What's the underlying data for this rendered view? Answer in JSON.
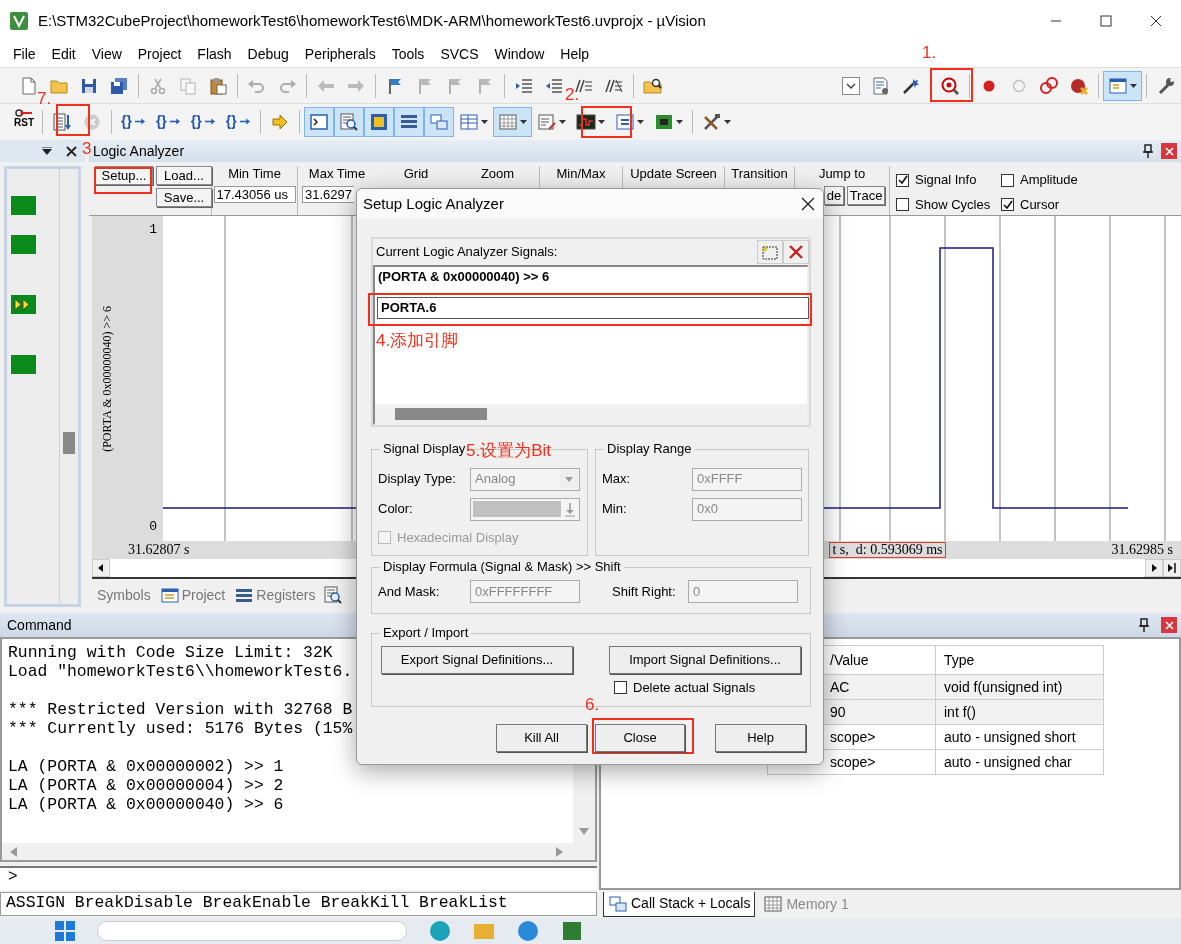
{
  "window": {
    "title": "E:\\STM32CubeProject\\homeworkTest6\\homeworkTest6\\MDK-ARM\\homeworkTest6.uvprojx - µVision"
  },
  "menu": [
    "File",
    "Edit",
    "View",
    "Project",
    "Flash",
    "Debug",
    "Peripherals",
    "Tools",
    "SVCS",
    "Window",
    "Help"
  ],
  "toolbar_1": {
    "left": [
      {
        "kind": "button",
        "disabled": false
      },
      {
        "kind": "button",
        "disabled": false
      },
      {
        "kind": "button",
        "disabled": false
      },
      {
        "kind": "button",
        "disabled": false
      },
      {
        "kind": "separator"
      },
      {
        "kind": "button",
        "disabled": true
      },
      {
        "kind": "button",
        "disabled": true
      },
      {
        "kind": "button",
        "disabled": false
      },
      {
        "kind": "separator"
      },
      {
        "kind": "button",
        "disabled": true
      },
      {
        "kind": "button",
        "disabled": true
      },
      {
        "kind": "separator"
      },
      {
        "kind": "button",
        "disabled": true
      },
      {
        "kind": "button",
        "disabled": true
      },
      {
        "kind": "separator"
      },
      {
        "kind": "button",
        "disabled": false
      },
      {
        "kind": "button",
        "disabled": true
      },
      {
        "kind": "button",
        "disabled": true
      },
      {
        "kind": "button",
        "disabled": true
      },
      {
        "kind": "separator"
      },
      {
        "kind": "button",
        "disabled": false
      },
      {
        "kind": "button",
        "disabled": false
      },
      {
        "kind": "button",
        "disabled": false
      },
      {
        "kind": "button",
        "disabled": false
      },
      {
        "kind": "separator"
      },
      {
        "kind": "button",
        "disabled": false
      }
    ],
    "right": [
      {
        "kind": "button",
        "disabled": false
      },
      {
        "kind": "button",
        "disabled": false
      },
      {
        "kind": "button",
        "disabled": false
      },
      {
        "kind": "separator"
      },
      {
        "kind": "button",
        "pressed": false
      },
      {
        "kind": "separator"
      },
      {
        "kind": "button",
        "disabled": false
      },
      {
        "kind": "button",
        "disabled": true
      },
      {
        "kind": "button",
        "disabled": false
      },
      {
        "kind": "button",
        "disabled": false
      },
      {
        "kind": "separator"
      },
      {
        "kind": "dropdown",
        "pressed": true
      },
      {
        "kind": "separator"
      },
      {
        "kind": "button",
        "disabled": false
      }
    ]
  },
  "toolbar_2": [
    {
      "kind": "button",
      "label": "RST"
    },
    {
      "kind": "separator"
    },
    {
      "kind": "button",
      "disabled": false
    },
    {
      "kind": "button",
      "disabled": true
    },
    {
      "kind": "separator"
    },
    {
      "kind": "button",
      "label": "{}"
    },
    {
      "kind": "button",
      "label": "{}"
    },
    {
      "kind": "button",
      "label": "{}"
    },
    {
      "kind": "button",
      "label": "{}"
    },
    {
      "kind": "separator"
    },
    {
      "kind": "button",
      "disabled": false
    },
    {
      "kind": "separator"
    },
    {
      "kind": "button",
      "pressed": true
    },
    {
      "kind": "button",
      "pressed": true
    },
    {
      "kind": "button",
      "pressed": true
    },
    {
      "kind": "button",
      "pressed": true
    },
    {
      "kind": "button",
      "pressed": true
    },
    {
      "kind": "dropdown",
      "pressed": false
    },
    {
      "kind": "dropdown",
      "pressed": true
    },
    {
      "kind": "dropdown",
      "pressed": false
    },
    {
      "kind": "dropdown",
      "pressed": false
    },
    {
      "kind": "dropdown",
      "pressed": false
    },
    {
      "kind": "dropdown",
      "pressed": false
    },
    {
      "kind": "separator"
    },
    {
      "kind": "dropdown",
      "pressed": false
    }
  ],
  "logic_analyzer": {
    "title": "Logic Analyzer",
    "buttons": [
      "Setup...",
      "Load...",
      "Save..."
    ],
    "min_time": {
      "label": "Min Time",
      "value": "17.43056 us"
    },
    "max_time": {
      "label": "Max Time",
      "value": "31.6297"
    },
    "headers": [
      "Grid",
      "Zoom",
      "Min/Max",
      "Update Screen",
      "Transition",
      "Jump to"
    ],
    "jump_buttons": [
      "de",
      "Trace"
    ],
    "options": [
      {
        "label": "Signal Info",
        "checked": true
      },
      {
        "label": "Amplitude",
        "checked": false
      },
      {
        "label": "Show Cycles",
        "checked": false
      },
      {
        "label": "Cursor",
        "checked": true
      }
    ],
    "y_max": "1",
    "y_min": "0",
    "signal_label": "(PORTA & 0x00000040) >> 6",
    "time_start": "31.62807 s",
    "cursor_info": "t s,  d: 0.593069 ms",
    "time_end": "31.62985 s"
  },
  "panel_tabs": [
    {
      "label": "Symbols",
      "selected": false
    },
    {
      "label": "Project",
      "selected": false
    },
    {
      "label": "Registers",
      "selected": false
    }
  ],
  "dialog": {
    "title": "Setup Logic Analyzer",
    "signals_label": "Current Logic Analyzer Signals:",
    "signals": [
      "(PORTA & 0x00000040) >> 6"
    ],
    "new_signal": "PORTA.6",
    "signal_display": {
      "title": "Signal Display",
      "disabled": true,
      "type_label": "Display Type:",
      "type": "Analog",
      "color_label": "Color:",
      "hex_label": "Hexadecimal Display",
      "hex_checked": false
    },
    "display_range": {
      "title": "Display Range",
      "disabled": true,
      "max_label": "Max:",
      "max": "0xFFFF",
      "min_label": "Min:",
      "min": "0x0"
    },
    "formula": {
      "title": "Display Formula (Signal & Mask) >> Shift",
      "disabled": true,
      "mask_label": "And Mask:",
      "mask": "0xFFFFFFFF",
      "shift_label": "Shift Right:",
      "shift": "0"
    },
    "export_import": {
      "title": "Export / Import",
      "export": "Export Signal Definitions...",
      "import": "Import Signal Definitions...",
      "delete_label": "Delete actual Signals",
      "delete_checked": false
    },
    "buttons": [
      "Kill All",
      "Close",
      "Help"
    ]
  },
  "command": {
    "title": "Command",
    "output_blocks": [
      [
        "Running with Code Size Limit: 32K",
        "Load \"homeworkTest6\\\\homeworkTest6."
      ],
      [
        "*** Restricted Version with 32768 B",
        "*** Currently used: 5176 Bytes (15%"
      ],
      [
        "LA (PORTA & 0x00000002) >> 1",
        "LA (PORTA & 0x00000004) >> 2",
        "LA (PORTA & 0x00000040) >> 6"
      ]
    ],
    "prompt": ">",
    "hints": "ASSIGN BreakDisable BreakEnable BreakKill BreakList"
  },
  "call_stack": {
    "columns": [
      "/Value",
      "Type"
    ],
    "rows": [
      [
        "AC",
        "void f(unsigned int)"
      ],
      [
        "90",
        "int f()"
      ],
      [
        "scope>",
        "auto - unsigned short"
      ],
      [
        "scope>",
        "auto - unsigned char"
      ]
    ],
    "tabs": [
      {
        "label": "Call Stack + Locals",
        "selected": true
      },
      {
        "label": "Memory 1",
        "selected": false
      }
    ]
  },
  "annotations": [
    {
      "label": "1.",
      "boxed": true
    },
    {
      "label": "2.",
      "boxed": true
    },
    {
      "label": "3",
      "boxed": true
    },
    {
      "label": "4.添加引脚",
      "boxed": true
    },
    {
      "label": "5.设置为Bit",
      "boxed": false
    },
    {
      "label": "6.",
      "boxed": true
    },
    {
      "label": "7.",
      "boxed": true
    }
  ]
}
